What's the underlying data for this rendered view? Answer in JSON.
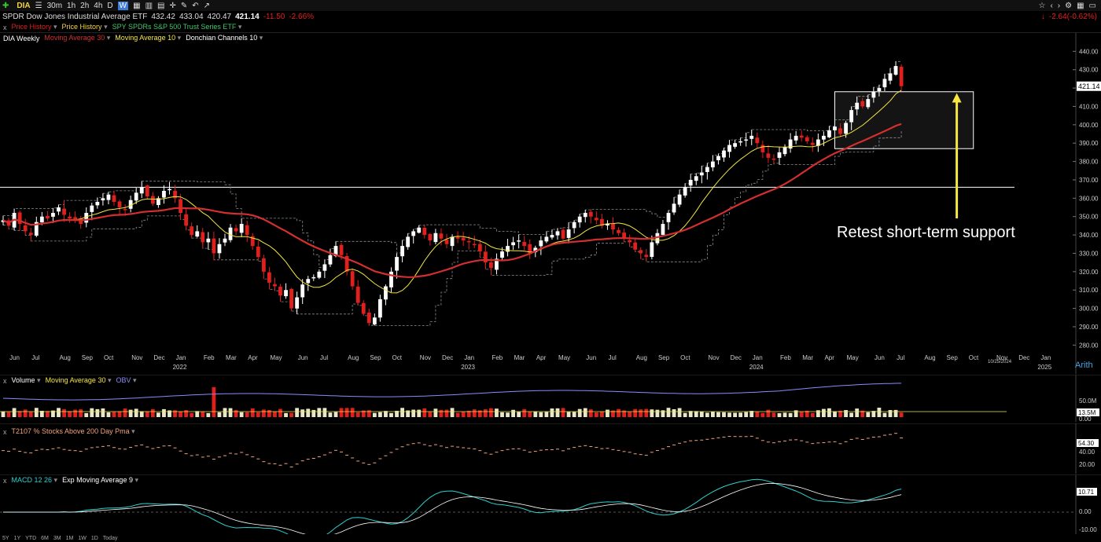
{
  "toolbar": {
    "symbol": "DIA",
    "timeframes": [
      "30m",
      "1h",
      "2h",
      "4h",
      "D",
      "W"
    ],
    "active": "W"
  },
  "quote": {
    "name": "SPDR Dow Jones Industrial Average ETF",
    "open": "432.42",
    "high": "433.04",
    "low": "420.47",
    "last": "421.14",
    "change": "-11.50",
    "pct": "-2.66%",
    "right_change": "-2.64(-0.62%)"
  },
  "overlays": [
    "Price History",
    "Price History",
    "SPY SPDRs S&P 500 Trust Series ETF"
  ],
  "price_panel": {
    "title": "DIA Weekly",
    "studies": [
      {
        "label": "Moving Average 30",
        "color": "#d32f2f"
      },
      {
        "label": "Moving Average 10",
        "color": "#f5e642"
      },
      {
        "label": "Donchian Channels 10",
        "color": "#dddddd"
      }
    ],
    "last_label": "421.14",
    "annotation": "Retest short-term support",
    "date_label": "10/25/2024",
    "arith": "Arith"
  },
  "volume_panel": {
    "title": "Volume",
    "ma": "Moving Average 30",
    "obv": "OBV",
    "labels": [
      "50.0M",
      "13.5M",
      "0.00"
    ]
  },
  "t2107_panel": {
    "title": "T2107 % Stocks Above 200 Day Pma",
    "labels": [
      "54.30",
      "40.00",
      "20.00"
    ]
  },
  "macd_panel": {
    "title": "MACD 12 26",
    "ema": "Exp Moving Average 9",
    "labels": [
      "10.71",
      "0.00",
      "-10.00"
    ]
  },
  "bottom": [
    "5Y",
    "1Y",
    "YTD",
    "6M",
    "3M",
    "1M",
    "1W",
    "1D",
    "Today"
  ],
  "colors": {
    "up": "#ffffff",
    "down": "#e0201c",
    "ma30": "#d32f2f",
    "ma10": "#f5e642",
    "donchian": "#8a8a8a",
    "annotation": "#f5e642"
  },
  "chart_data": {
    "type": "candlestick",
    "title": "DIA Weekly",
    "ylim": [
      278,
      444
    ],
    "y_ticks": [
      280,
      290,
      300,
      310,
      320,
      330,
      340,
      350,
      360,
      370,
      380,
      390,
      400,
      410,
      420,
      430,
      440
    ],
    "x_labels": [
      {
        "t": "Jun",
        "w": 2
      },
      {
        "t": "Jul",
        "w": 6
      },
      {
        "t": "Aug",
        "w": 11
      },
      {
        "t": "Sep",
        "w": 15
      },
      {
        "t": "Oct",
        "w": 19
      },
      {
        "t": "Nov",
        "w": 24
      },
      {
        "t": "Dec",
        "w": 28
      },
      {
        "t": "Jan",
        "w": 32
      },
      {
        "t": "Feb",
        "w": 37
      },
      {
        "t": "Mar",
        "w": 41
      },
      {
        "t": "Apr",
        "w": 45
      },
      {
        "t": "May",
        "w": 49
      },
      {
        "t": "Jun",
        "w": 54
      },
      {
        "t": "Jul",
        "w": 58
      },
      {
        "t": "Aug",
        "w": 63
      },
      {
        "t": "Sep",
        "w": 67
      },
      {
        "t": "Oct",
        "w": 71
      },
      {
        "t": "Nov",
        "w": 76
      },
      {
        "t": "Dec",
        "w": 80
      },
      {
        "t": "Jan",
        "w": 84
      },
      {
        "t": "Feb",
        "w": 89
      },
      {
        "t": "Mar",
        "w": 93
      },
      {
        "t": "Apr",
        "w": 97
      },
      {
        "t": "May",
        "w": 101
      },
      {
        "t": "Jun",
        "w": 106
      },
      {
        "t": "Jul",
        "w": 110
      },
      {
        "t": "Aug",
        "w": 115
      },
      {
        "t": "Sep",
        "w": 119
      },
      {
        "t": "Oct",
        "w": 123
      },
      {
        "t": "Nov",
        "w": 128
      },
      {
        "t": "Dec",
        "w": 132
      },
      {
        "t": "Jan",
        "w": 136
      },
      {
        "t": "Feb",
        "w": 141
      },
      {
        "t": "Mar",
        "w": 145
      },
      {
        "t": "Apr",
        "w": 149
      },
      {
        "t": "May",
        "w": 153
      },
      {
        "t": "Jun",
        "w": 158
      },
      {
        "t": "Jul",
        "w": 162
      },
      {
        "t": "Aug",
        "w": 167
      },
      {
        "t": "Sep",
        "w": 171
      },
      {
        "t": "Oct",
        "w": 175
      },
      {
        "t": "Nov",
        "w": 180
      },
      {
        "t": "Dec",
        "w": 184
      },
      {
        "t": "Jan",
        "w": 188
      }
    ],
    "year_labels": [
      {
        "t": "2022",
        "w": 32
      },
      {
        "t": "2023",
        "w": 84
      },
      {
        "t": "2024",
        "w": 136
      },
      {
        "t": "2025",
        "w": 188
      }
    ],
    "closes": [
      348,
      345,
      352,
      346,
      342,
      340,
      347,
      350,
      349,
      352,
      355,
      351,
      349,
      348,
      346,
      352,
      356,
      358,
      360,
      362,
      358,
      355,
      354,
      359,
      363,
      366,
      361,
      357,
      360,
      364,
      365,
      360,
      352,
      345,
      340,
      342,
      336,
      338,
      330,
      335,
      338,
      344,
      342,
      346,
      340,
      334,
      328,
      320,
      314,
      312,
      307,
      310,
      300,
      306,
      313,
      316,
      317,
      320,
      324,
      329,
      334,
      329,
      320,
      312,
      303,
      297,
      292,
      295,
      305,
      312,
      320,
      328,
      334,
      339,
      342,
      344,
      340,
      337,
      341,
      338,
      335,
      339,
      338,
      337,
      336,
      335,
      331,
      325,
      322,
      327,
      331,
      334,
      336,
      337,
      334,
      330,
      333,
      337,
      339,
      340,
      342,
      338,
      343,
      347,
      350,
      352,
      350,
      348,
      345,
      346,
      343,
      341,
      338,
      336,
      332,
      330,
      328,
      336,
      341,
      346,
      352,
      357,
      362,
      366,
      370,
      372,
      374,
      377,
      380,
      383,
      386,
      389,
      390,
      391,
      392,
      394,
      390,
      385,
      382,
      381,
      385,
      388,
      392,
      394,
      393,
      391,
      389,
      392,
      394,
      397,
      399,
      395,
      401,
      408,
      412,
      410,
      414,
      418,
      420,
      425,
      428,
      432,
      421
    ],
    "ma10_range": [
      318,
      419
    ],
    "ma30_range": [
      312,
      402
    ],
    "horizontal_line": 366,
    "box": {
      "start_w": 150,
      "end_w": 175,
      "low": 387,
      "high": 418
    },
    "arrow": {
      "w": 172,
      "from": 349,
      "to": 416
    }
  }
}
